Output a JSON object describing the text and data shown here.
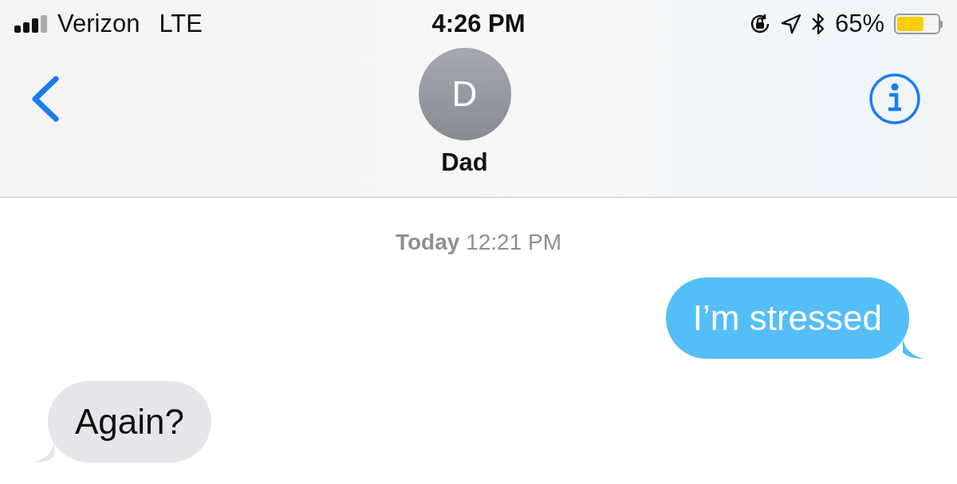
{
  "status_bar": {
    "carrier": "Verizon",
    "network": "LTE",
    "time": "4:26 PM",
    "battery_text": "65%",
    "battery": {
      "level": 0.65
    }
  },
  "header": {
    "avatar_initial": "D",
    "contact_name": "Dad"
  },
  "timestamp": {
    "day": "Today",
    "time": "12:21 PM"
  },
  "messages": [
    {
      "kind": "sent",
      "text": "I’m stressed"
    },
    {
      "kind": "received",
      "text": "Again?"
    }
  ]
}
